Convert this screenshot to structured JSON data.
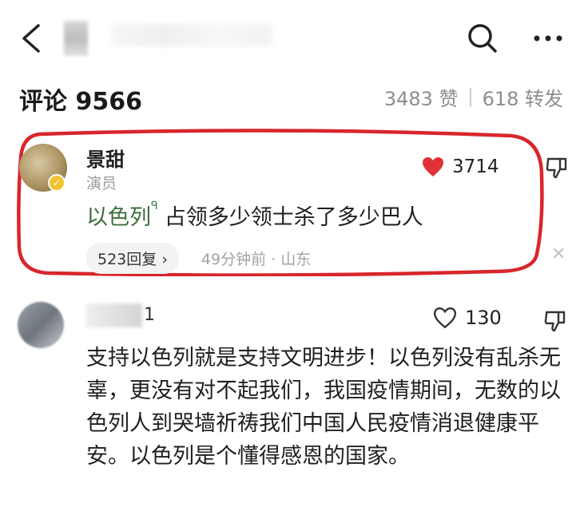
{
  "header": {
    "back_icon": "chevron-left-icon",
    "search_icon": "search-icon",
    "more_icon": "more-horizontal-icon"
  },
  "comments_section": {
    "title": "评论 9566",
    "likes": "3483 赞",
    "reposts": "618 转发"
  },
  "comments": [
    {
      "author": "景甜",
      "role": "演员",
      "verified": true,
      "likes": "3714",
      "liked": true,
      "tag": "以色列",
      "text": "占领多少领士杀了多少巴人",
      "replies": "523回复",
      "time_location": "49分钟前 · 山东",
      "highlight_color": "#d8262c"
    },
    {
      "author_suffix": "1",
      "likes": "130",
      "liked": false,
      "text": "支持以色列就是支持文明进步！以色列没有乱杀无辜，更没有对不起我们，我国疫情期间，无数的以色列人到哭墙祈祷我们中国人民疫情消退健康平安。以色列是个懂得感恩的国家。"
    }
  ],
  "colors": {
    "heart_active": "#e0303a",
    "tag_text": "#3a6e3a",
    "muted": "#9a9a9a"
  }
}
